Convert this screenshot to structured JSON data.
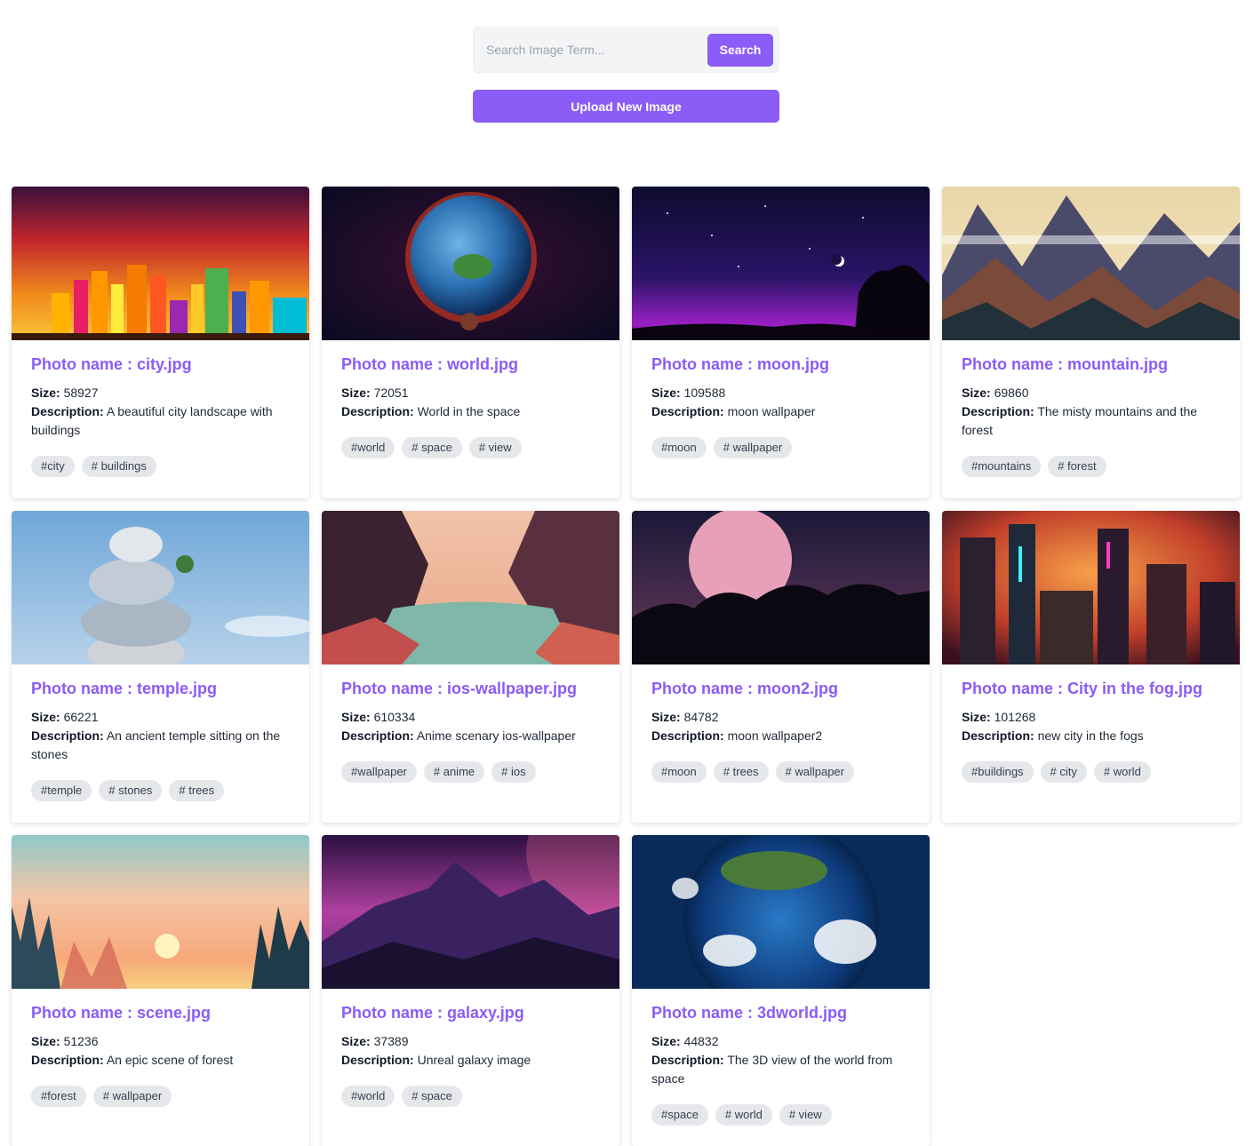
{
  "search": {
    "placeholder": "Search Image Term...",
    "button_label": "Search"
  },
  "upload": {
    "button_label": "Upload New Image"
  },
  "labels": {
    "size": "Size:",
    "description": "Description:"
  },
  "cards": [
    {
      "title": "Photo name : city.jpg",
      "size": "58927",
      "description": "A beautiful city landscape with buildings",
      "tags": [
        "#city",
        "# buildings"
      ],
      "image": "city-skyline-sunset"
    },
    {
      "title": "Photo name : world.jpg",
      "size": "72051",
      "description": "World in the space",
      "tags": [
        "#world",
        "# space",
        "# view"
      ],
      "image": "earth-in-space"
    },
    {
      "title": "Photo name : moon.jpg",
      "size": "109588",
      "description": "moon wallpaper",
      "tags": [
        "#moon",
        "# wallpaper"
      ],
      "image": "crescent-moon-night"
    },
    {
      "title": "Photo name : mountain.jpg",
      "size": "69860",
      "description": "The misty mountains and the forest",
      "tags": [
        "#mountains",
        "# forest"
      ],
      "image": "misty-mountains"
    },
    {
      "title": "Photo name : temple.jpg",
      "size": "66221",
      "description": "An ancient temple sitting on the stones",
      "tags": [
        "#temple",
        "# stones",
        "# trees"
      ],
      "image": "stacked-stones-sky"
    },
    {
      "title": "Photo name : ios-wallpaper.jpg",
      "size": "610334",
      "description": "Anime scenary ios-wallpaper",
      "tags": [
        "#wallpaper",
        "# anime",
        "# ios"
      ],
      "image": "canyon-river"
    },
    {
      "title": "Photo name : moon2.jpg",
      "size": "84782",
      "description": "moon wallpaper2",
      "tags": [
        "#moon",
        "# trees",
        "# wallpaper"
      ],
      "image": "pink-moon-trees"
    },
    {
      "title": "Photo name : City in the fog.jpg",
      "size": "101268",
      "description": "new city in the fogs",
      "tags": [
        "#buildings",
        "# city",
        "# world"
      ],
      "image": "neon-city-fog"
    },
    {
      "title": "Photo name : scene.jpg",
      "size": "51236",
      "description": "An epic scene of forest",
      "tags": [
        "#forest",
        "# wallpaper"
      ],
      "image": "forest-sunset"
    },
    {
      "title": "Photo name : galaxy.jpg",
      "size": "37389",
      "description": "Unreal galaxy image",
      "tags": [
        "#world",
        "# space"
      ],
      "image": "purple-mountains"
    },
    {
      "title": "Photo name : 3dworld.jpg",
      "size": "44832",
      "description": "The 3D view of the world from space",
      "tags": [
        "#space",
        "# world",
        "# view"
      ],
      "image": "3d-earth-clouds"
    }
  ]
}
